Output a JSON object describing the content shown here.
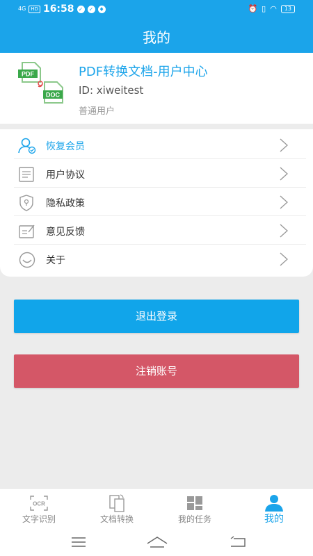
{
  "status_bar": {
    "signal": "4G",
    "hd": "HD",
    "time": "16:58",
    "battery": "13"
  },
  "header": {
    "title": "我的"
  },
  "profile": {
    "logo_pdf": "PDF",
    "logo_doc": "DOC",
    "name": "PDF转换文档-用户中心",
    "id": "ID: xiweitest",
    "level": "普通用户"
  },
  "menu": {
    "items": [
      {
        "label": "恢复会员",
        "icon": "user-restore-icon"
      },
      {
        "label": "用户协议",
        "icon": "document-icon"
      },
      {
        "label": "隐私政策",
        "icon": "shield-lock-icon"
      },
      {
        "label": "意见反馈",
        "icon": "feedback-icon"
      },
      {
        "label": "关于",
        "icon": "smile-icon"
      }
    ]
  },
  "actions": {
    "logout": "退出登录",
    "cancel_account": "注销账号"
  },
  "tabs": [
    {
      "label": "文字识别",
      "icon": "ocr-icon",
      "icon_text": "OCR"
    },
    {
      "label": "文档转换",
      "icon": "convert-icon"
    },
    {
      "label": "我的任务",
      "icon": "grid-icon"
    },
    {
      "label": "我的",
      "icon": "person-icon"
    }
  ],
  "colors": {
    "primary": "#1ba4ea",
    "danger": "#d45767",
    "background": "#ececec"
  }
}
